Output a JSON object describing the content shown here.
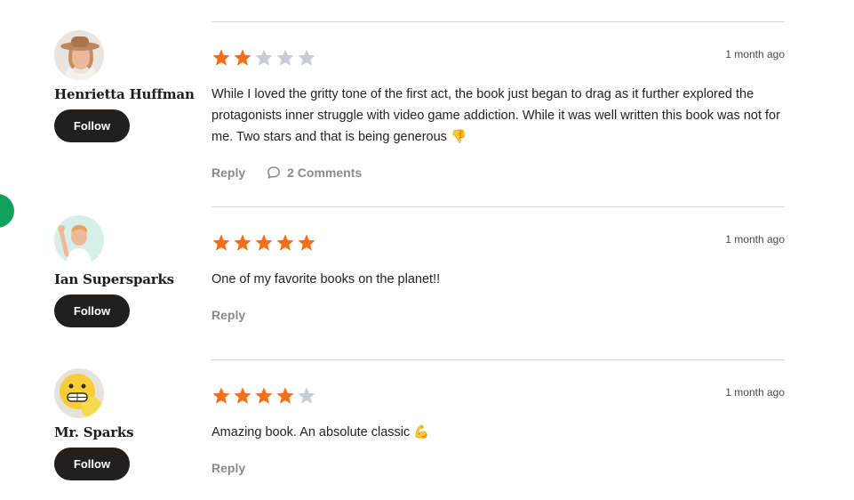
{
  "colors": {
    "star_filled": "#f26f1a",
    "star_empty": "#c9ccd4",
    "follow_button_bg": "#231f1c",
    "action_text": "#8a8a8a",
    "edge_dot": "#12a15c"
  },
  "reviews": [
    {
      "reviewer": "Henrietta Huffman",
      "avatar_icon": "woman-with-hat-avatar",
      "follow_label": "Follow",
      "rating": 2,
      "max_rating": 5,
      "time": "1 month ago",
      "text": "While I loved the gritty tone of the first act, the book just began to drag as it further explored the protagonists inner struggle with video game addiction. While it was well written this book was not for me. Two stars and that is being generous 👎",
      "reply_label": "Reply",
      "comments_label": "2 Comments",
      "comments_icon": "speech-bubble-icon"
    },
    {
      "reviewer": "Ian Supersparks",
      "avatar_icon": "waving-character-avatar",
      "follow_label": "Follow",
      "rating": 5,
      "max_rating": 5,
      "time": "1 month ago",
      "text": "One of my favorite books on the planet!!",
      "reply_label": "Reply"
    },
    {
      "reviewer": "Mr. Sparks",
      "avatar_icon": "grinning-emoji-avatar",
      "follow_label": "Follow",
      "rating": 4,
      "max_rating": 5,
      "time": "1 month ago",
      "text": "Amazing book. An absolute classic 💪",
      "reply_label": "Reply"
    }
  ]
}
